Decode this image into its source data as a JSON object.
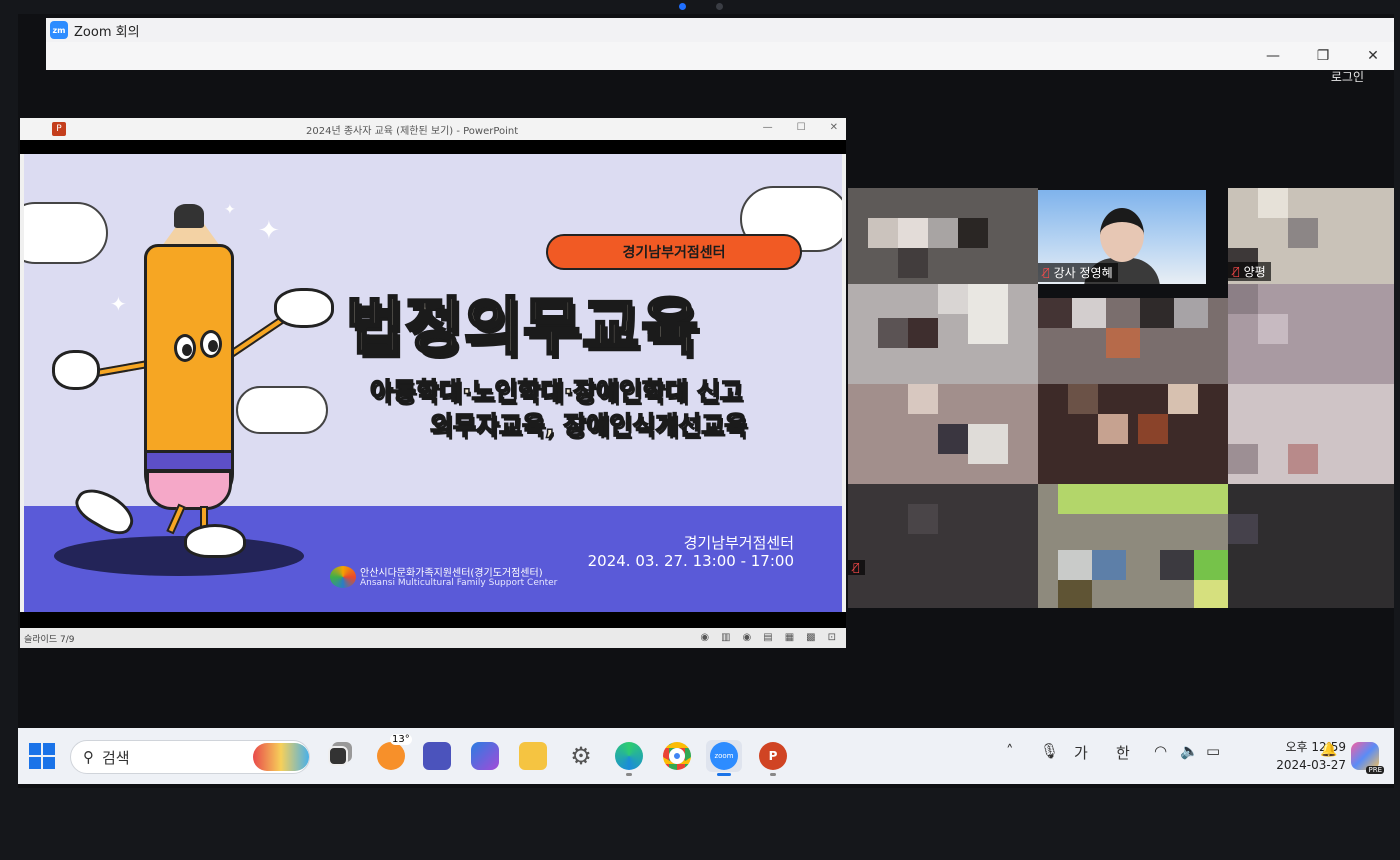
{
  "zoom": {
    "window_title": "Zoom 회의",
    "logo": "zm",
    "login_label": "로그인",
    "minimize": "—",
    "restore": "❐",
    "close": "✕"
  },
  "powerpoint": {
    "window_title": "2024년 종사자 교육 (제한된 보기) - PowerPoint",
    "status_slide": "슬라이드 7/9",
    "slide": {
      "badge": "경기남부거점센터",
      "title": "법정의무교육",
      "subtitle_line1": "아동학대·노인학대·장애인학대 신고",
      "subtitle_line2": "의무자교육, 장애인식개선교육",
      "organizer": "경기남부거점센터",
      "datetime": "2024. 03. 27. 13:00 - 17:00",
      "logo_korean": "안산시다문화가족지원센터(경기도거점센터)",
      "logo_english": "Ansansi Multicultural Family Support Center"
    }
  },
  "gallery": {
    "speaker_label": "강사 정영혜",
    "participant_label": "양평"
  },
  "taskbar": {
    "search_placeholder": "검색",
    "weather_badge": "13°",
    "ime_lang": "가",
    "ime_mode": "한",
    "clock_time": "오후 12:59",
    "clock_date": "2024-03-27",
    "copilot_badge": "PRE"
  },
  "colors": {
    "slide_bg": "#dcdcf2",
    "slide_band": "#5a5ad8",
    "badge_orange": "#f15a24",
    "zoom_blue": "#2d8cff"
  }
}
